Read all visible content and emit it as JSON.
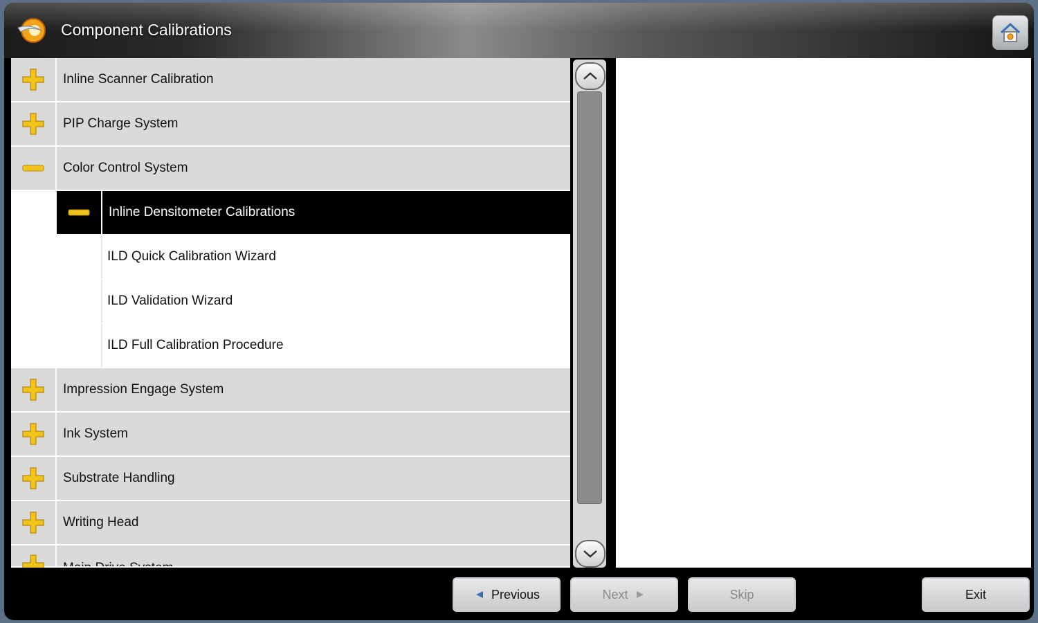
{
  "window": {
    "title": "Component Calibrations"
  },
  "icons": {
    "logo": "swoosh-logo-icon",
    "home": "home-icon",
    "expand": "plus-icon",
    "collapse": "minus-icon",
    "scroll_up": "chevron-up-icon",
    "scroll_down": "chevron-down-icon",
    "previous": "arrow-left-icon",
    "next": "arrow-right-icon"
  },
  "colors": {
    "accent_yellow": "#f2c31a",
    "selected_bg": "#000000",
    "row_bg": "#dadada"
  },
  "tree": {
    "items": [
      {
        "label": "Inline Scanner Calibration",
        "state": "collapsed"
      },
      {
        "label": "PIP Charge System",
        "state": "collapsed"
      },
      {
        "label": "Color Control System",
        "state": "expanded"
      },
      {
        "label": "Inline Densitometer Calibrations",
        "state": "expanded",
        "selected": true
      },
      {
        "label": "ILD Quick Calibration Wizard"
      },
      {
        "label": "ILD Validation Wizard"
      },
      {
        "label": "ILD Full Calibration Procedure"
      },
      {
        "label": "Impression Engage System",
        "state": "collapsed"
      },
      {
        "label": "Ink System",
        "state": "collapsed"
      },
      {
        "label": "Substrate Handling",
        "state": "collapsed"
      },
      {
        "label": "Writing Head",
        "state": "collapsed"
      },
      {
        "label": "Main Drive System",
        "state": "collapsed"
      }
    ]
  },
  "buttons": {
    "previous": "Previous",
    "next": "Next",
    "skip": "Skip",
    "exit": "Exit"
  }
}
